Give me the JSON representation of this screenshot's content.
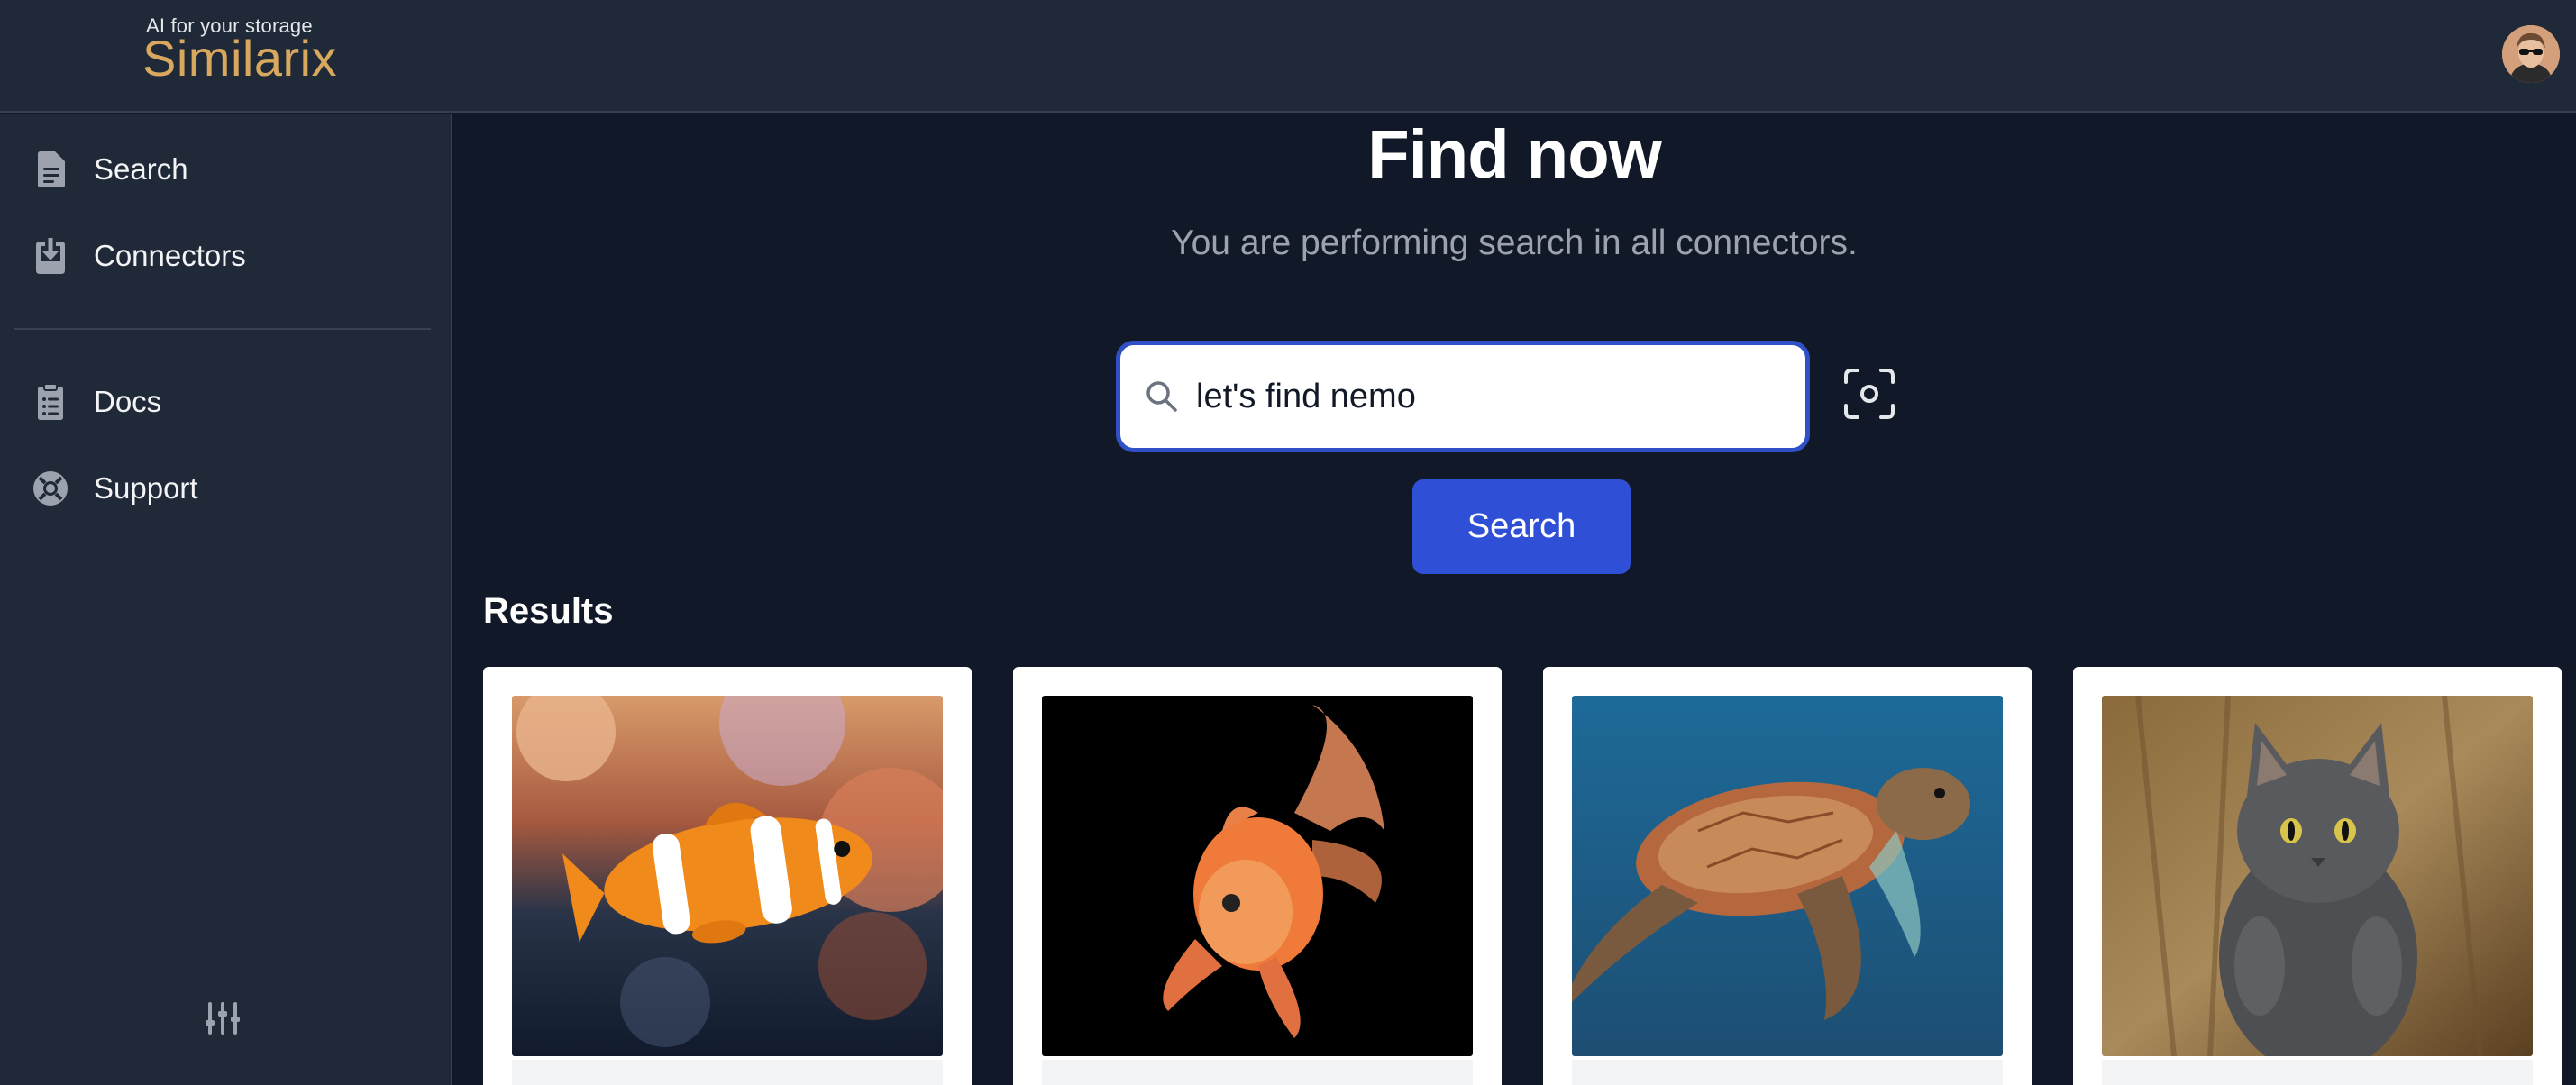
{
  "header": {
    "logo_tagline": "AI for your storage",
    "logo_name": "Similarix",
    "avatar_icon": "user-avatar"
  },
  "sidebar": {
    "items": [
      {
        "label": "Search",
        "icon": "document-icon"
      },
      {
        "label": "Connectors",
        "icon": "download-tray-icon"
      },
      {
        "label": "Docs",
        "icon": "clipboard-icon"
      },
      {
        "label": "Support",
        "icon": "lifebuoy-icon"
      }
    ],
    "settings_icon": "sliders-icon"
  },
  "main": {
    "title": "Find now",
    "subtitle": "You are performing search in all connectors.",
    "search": {
      "value": "let's find nemo",
      "icon": "search-icon"
    },
    "camera_icon": "camera-scan-icon",
    "search_button_label": "Search",
    "results_heading": "Results",
    "results": [
      {
        "image": "clownfish-photo"
      },
      {
        "image": "goldfish-photo"
      },
      {
        "image": "sea-turtle-photo"
      },
      {
        "image": "gray-cat-photo"
      }
    ]
  },
  "colors": {
    "background": "#111827",
    "panel": "#1f2937",
    "accent": "#2f50d6",
    "logo": "#d9a85f"
  }
}
